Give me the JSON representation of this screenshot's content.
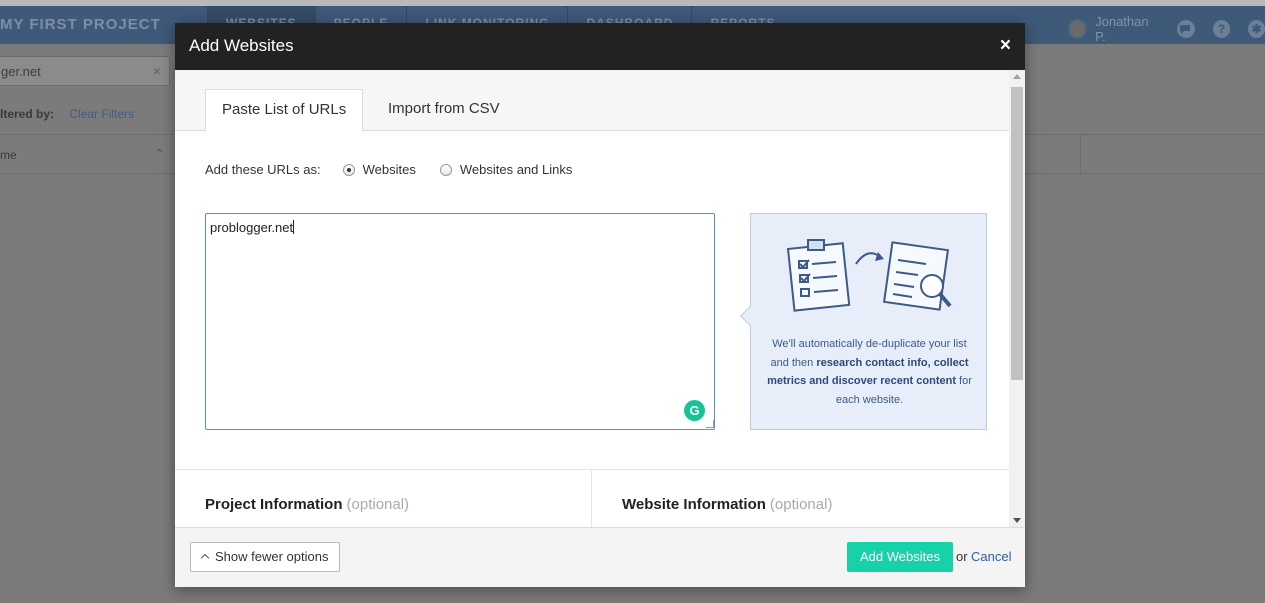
{
  "app": {
    "project_name": "MY FIRST PROJECT",
    "nav_tabs": [
      "WEBSITES",
      "PEOPLE",
      "LINK MONITORING",
      "DASHBOARD",
      "REPORTS"
    ],
    "user_name": "Jonathan P.",
    "icons": [
      "chat-icon",
      "help-icon",
      "gear-icon"
    ],
    "search_value": "ger.net",
    "filter_label": "ltered by:",
    "clear_filters": "Clear Filters",
    "column_name": "me"
  },
  "modal": {
    "title": "Add Websites",
    "close": "×",
    "tabs": [
      "Paste List of URLs",
      "Import from CSV"
    ],
    "active_tab": "Paste List of URLs",
    "add_as_label": "Add these URLs as:",
    "radio_options": [
      "Websites",
      "Websites and Links"
    ],
    "selected_radio": "Websites",
    "urls_value": "problogger.net",
    "info": {
      "text_1": "We'll automatically de-duplicate your list and then ",
      "text_bold": "research contact info, collect metrics and discover recent content",
      "text_2": " for each website."
    },
    "sections": {
      "project_title": "Project Information",
      "website_title": "Website Information",
      "optional": "(optional)"
    },
    "footer": {
      "fewer_options": "Show fewer options",
      "add_button": "Add Websites",
      "or": "or",
      "cancel": "Cancel"
    }
  },
  "colors": {
    "nav_bg": "#3f5978",
    "modal_header": "#222222",
    "add_button": "#17d1a8",
    "link": "#2e5fa8",
    "info_panel_bg": "#e7eef9"
  }
}
